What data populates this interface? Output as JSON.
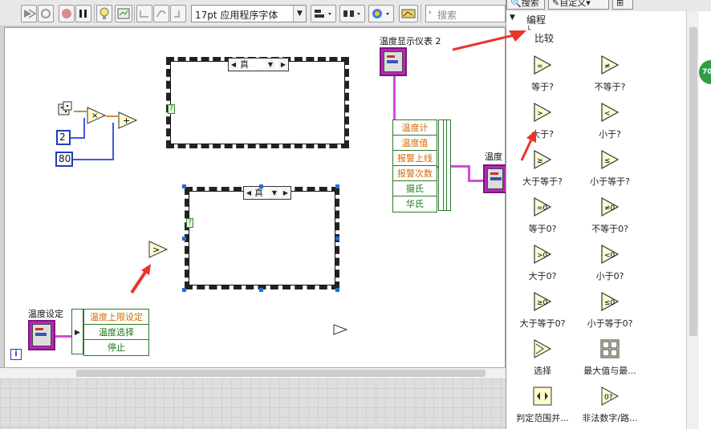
{
  "toolbar": {
    "font_select": "17pt 应用程序字体",
    "search_placeholder": "搜索"
  },
  "diagram": {
    "case_selector_1": "真",
    "case_selector_2": "真",
    "case_terminal": "?",
    "const_2": "2",
    "const_80": "80",
    "label_display": "温度显示仪表 2",
    "label_display_partial": "温度",
    "label_settings": "温度设定",
    "bundle_right": [
      "温度计",
      "温度值",
      "报警上线",
      "报警次数",
      "摄氏",
      "华氏"
    ],
    "bundle_left": [
      "温度上限设定",
      "温度选择",
      "停止"
    ],
    "info_icon": "i"
  },
  "palette": {
    "search_btn": "搜索",
    "custom_btn": "自定义",
    "tree_parent": "编程",
    "tree_child": "比较",
    "badge": "70",
    "items": [
      {
        "label": "等于?",
        "icon": "equal-icon"
      },
      {
        "label": "不等于?",
        "icon": "not-equal-icon"
      },
      {
        "label": "大于?",
        "icon": "greater-icon"
      },
      {
        "label": "小于?",
        "icon": "less-icon"
      },
      {
        "label": "大于等于?",
        "icon": "greater-equal-icon"
      },
      {
        "label": "小于等于?",
        "icon": "less-equal-icon"
      },
      {
        "label": "等于0?",
        "icon": "equal-zero-icon"
      },
      {
        "label": "不等于0?",
        "icon": "not-equal-zero-icon"
      },
      {
        "label": "大于0?",
        "icon": "greater-zero-icon"
      },
      {
        "label": "小于0?",
        "icon": "less-zero-icon"
      },
      {
        "label": "大于等于0?",
        "icon": "greater-equal-zero-icon"
      },
      {
        "label": "小于等于0?",
        "icon": "less-equal-zero-icon"
      },
      {
        "label": "选择",
        "icon": "select-icon"
      },
      {
        "label": "最大值与最...",
        "icon": "max-min-icon"
      },
      {
        "label": "判定范围并...",
        "icon": "in-range-icon"
      },
      {
        "label": "非法数字/路...",
        "icon": "not-a-number-icon"
      }
    ]
  },
  "colors": {
    "wire_pink": "#d44cd8",
    "annotation_red": "#e8352b",
    "terminal_green": "#2e9e47"
  }
}
